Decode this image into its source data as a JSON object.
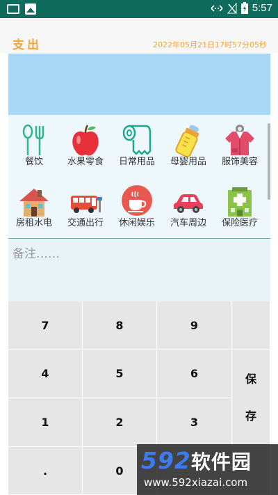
{
  "status_bar": {
    "time": "5:57"
  },
  "header": {
    "title": "支出",
    "datetime": "2022年05月21日17时57分05秒"
  },
  "categories": [
    {
      "label": "餐饮",
      "icon": "fork-spoon-icon"
    },
    {
      "label": "水果零食",
      "icon": "apple-icon"
    },
    {
      "label": "日常用品",
      "icon": "tissue-roll-icon"
    },
    {
      "label": "母婴用品",
      "icon": "baby-bottle-icon"
    },
    {
      "label": "服饰美容",
      "icon": "shirt-icon"
    },
    {
      "label": "房租水电",
      "icon": "house-icon"
    },
    {
      "label": "交通出行",
      "icon": "bus-icon"
    },
    {
      "label": "休闲娱乐",
      "icon": "coffee-cup-icon"
    },
    {
      "label": "汽车周边",
      "icon": "car-icon"
    },
    {
      "label": "保险医疗",
      "icon": "hospital-icon"
    }
  ],
  "note": {
    "placeholder": "备注……",
    "value": ""
  },
  "keypad": {
    "k7": "7",
    "k8": "8",
    "k9": "9",
    "k4": "4",
    "k5": "5",
    "k6": "6",
    "k1": "1",
    "k2": "2",
    "k3": "3",
    "kdot": ".",
    "k0": "0",
    "save": "保\n\n\n存"
  },
  "watermark": {
    "brand_digits": "592",
    "brand_text": "软件园",
    "url": "www.592xiazai.com"
  },
  "colors": {
    "status_bar": "#0f6b5c",
    "accent": "#f4a53c",
    "amount_panel": "#a8d8f6"
  }
}
